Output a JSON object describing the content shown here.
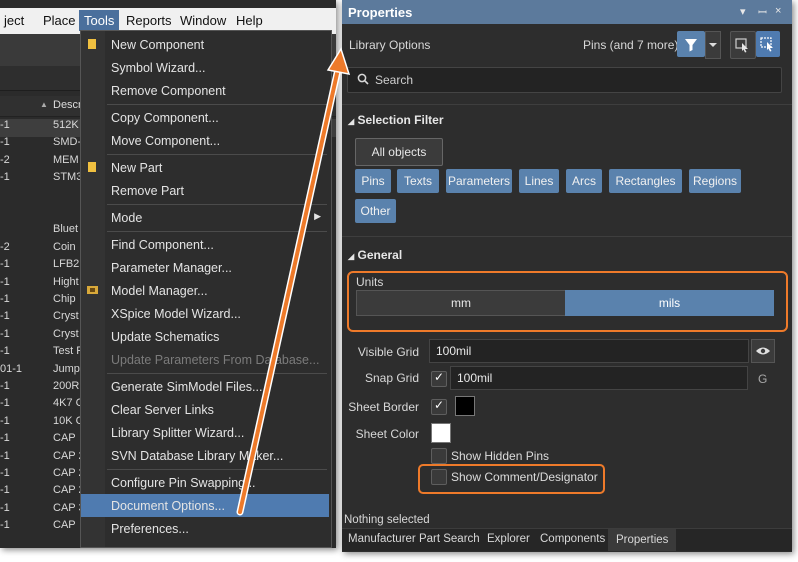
{
  "menubar": {
    "items": [
      "ject",
      "Place",
      "Tools",
      "Reports",
      "Window",
      "Help"
    ]
  },
  "app_list": {
    "header": "Descr",
    "rows": [
      {
        "c1": "-1",
        "c2": "512K"
      },
      {
        "c1": "-1",
        "c2": "SMD-"
      },
      {
        "c1": "-2",
        "c2": "MEM"
      },
      {
        "c1": "-1",
        "c2": "STM3"
      },
      {
        "c1": "",
        "c2": ""
      },
      {
        "c1": "",
        "c2": ""
      },
      {
        "c1": "",
        "c2": "Bluet"
      },
      {
        "c1": "-2",
        "c2": "Coin"
      },
      {
        "c1": "-1",
        "c2": "LFB2"
      },
      {
        "c1": "-1",
        "c2": "Hight"
      },
      {
        "c1": "-1",
        "c2": "Chip"
      },
      {
        "c1": "-1",
        "c2": "Cryst"
      },
      {
        "c1": "-1",
        "c2": "Cryst"
      },
      {
        "c1": "-1",
        "c2": "Test F"
      },
      {
        "c1": "01-1",
        "c2": "Jump"
      },
      {
        "c1": "-1",
        "c2": "200R"
      },
      {
        "c1": "-1",
        "c2": "4K7 C"
      },
      {
        "c1": "-1",
        "c2": "10K C"
      },
      {
        "c1": "-1",
        "c2": "CAP"
      },
      {
        "c1": "-1",
        "c2": "CAP 2"
      },
      {
        "c1": "-1",
        "c2": "CAP 2"
      },
      {
        "c1": "-1",
        "c2": "CAP 2"
      },
      {
        "c1": "-1",
        "c2": "CAP 3"
      },
      {
        "c1": "-1",
        "c2": "CAP"
      }
    ]
  },
  "tools_menu": {
    "groups": [
      [
        {
          "label": "New Component",
          "icon": "new-component-icon"
        },
        {
          "label": "Symbol Wizard..."
        },
        {
          "label": "Remove Component"
        }
      ],
      [
        {
          "label": "Copy Component..."
        },
        {
          "label": "Move Component..."
        }
      ],
      [
        {
          "label": "New Part",
          "icon": "new-part-icon"
        },
        {
          "label": "Remove Part"
        }
      ],
      [
        {
          "label": "Mode",
          "submenu": true
        }
      ],
      [
        {
          "label": "Find Component..."
        },
        {
          "label": "Parameter Manager..."
        },
        {
          "label": "Model Manager...",
          "icon": "model-manager-icon"
        },
        {
          "label": "XSpice Model Wizard..."
        },
        {
          "label": "Update Schematics"
        },
        {
          "label": "Update Parameters From Database...",
          "disabled": true
        }
      ],
      [
        {
          "label": "Generate SimModel Files..."
        },
        {
          "label": "Clear Server Links"
        },
        {
          "label": "Library Splitter Wizard..."
        },
        {
          "label": "SVN Database Library Maker..."
        }
      ],
      [
        {
          "label": "Configure Pin Swapping..."
        },
        {
          "label": "Document Options...",
          "highlighted": true
        },
        {
          "label": "Preferences..."
        }
      ]
    ]
  },
  "properties": {
    "title": "Properties",
    "library_label": "Library Options",
    "filter_summary": "Pins (and 7 more)",
    "search_placeholder": "Search",
    "selection_filter": {
      "heading": "Selection Filter",
      "all_objects": "All objects",
      "chips": [
        "Pins",
        "Texts",
        "Parameters",
        "Lines",
        "Arcs",
        "Rectangles",
        "Regions",
        "Other"
      ]
    },
    "general": {
      "heading": "General",
      "units_label": "Units",
      "units_options": [
        "mm",
        "mils"
      ],
      "units_selected": "mils",
      "visible_grid_label": "Visible Grid",
      "visible_grid_value": "100mil",
      "snap_grid_label": "Snap Grid",
      "snap_grid_value": "100mil",
      "snap_grid_shortcut": "G",
      "sheet_border_label": "Sheet Border",
      "sheet_border_color": "#000000",
      "sheet_color_label": "Sheet Color",
      "sheet_color": "#ffffff",
      "show_hidden_pins": "Show Hidden Pins",
      "show_comment_designator": "Show Comment/Designator"
    },
    "status": "Nothing selected",
    "tabs": [
      "Manufacturer Part Search",
      "Explorer",
      "Components",
      "Properties"
    ],
    "active_tab": "Properties"
  },
  "colors": {
    "accent_orange": "#ee7a2a",
    "chip_blue": "#5a82ad",
    "highlight_blue": "#4f7bb0"
  }
}
